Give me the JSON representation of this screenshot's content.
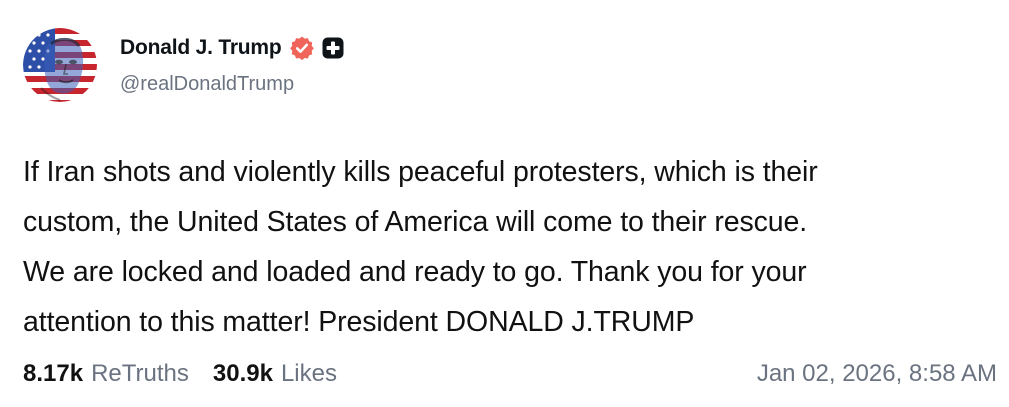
{
  "author": {
    "display_name": "Donald J. Trump",
    "handle": "@realDonaldTrump",
    "avatar_icon": "flag-portrait-avatar",
    "verified_icon": "verified-badge-icon",
    "extra_icon": "plus-badge-icon"
  },
  "post": {
    "lines": [
      "If Iran shots and violently kills peaceful protesters, which is their",
      "custom, the United States of America will come to their rescue.",
      "We are locked and loaded and ready to go. Thank you for your",
      "attention to this matter! President DONALD J.TRUMP"
    ]
  },
  "stats": {
    "retruths_count": "8.17k",
    "retruths_label": "ReTruths",
    "likes_count": "30.9k",
    "likes_label": "Likes"
  },
  "timestamp": "Jan 02, 2026, 8:58 AM",
  "colors": {
    "verified_badge": "#f0655a",
    "secondary_text": "#6b7380",
    "primary_text": "#111111"
  }
}
